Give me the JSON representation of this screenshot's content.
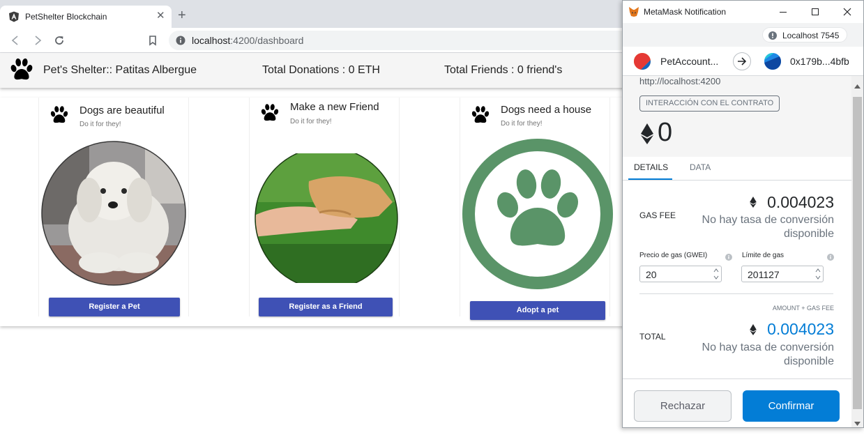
{
  "browser": {
    "tab_title": "PetShelter Blockchain",
    "tab_close": "✕",
    "new_tab": "+",
    "url_host": "localhost",
    "url_path": ":4200/dashboard"
  },
  "app": {
    "title": "Pet's Shelter:: Patitas Albergue",
    "donations": "Total Donations : 0 ETH",
    "friends": "Total Friends : 0 friend's"
  },
  "cards": [
    {
      "title": "Dogs are beautiful",
      "subtitle": "Do it for they!",
      "image": "white-dog-photo",
      "button": "Register a Pet"
    },
    {
      "title": "Make a new Friend",
      "subtitle": "Do it for they!",
      "image": "hand-and-paw-photo",
      "button": "Register as a Friend"
    },
    {
      "title": "Dogs need a house",
      "subtitle": "Do it for they!",
      "image": "green-paw-logo",
      "button": "Adopt a pet"
    }
  ],
  "metamask": {
    "window_title": "MetaMask Notification",
    "network": "Localhost 7545",
    "from_account": "PetAccount...",
    "to_account": "0x179b...4bfb",
    "origin": "http://localhost:4200",
    "interaction_badge": "INTERACCIÓN CON EL CONTRATO",
    "amount": "0",
    "tabs": {
      "details": "DETAILS",
      "data": "DATA"
    },
    "gas_fee_label": "GAS FEE",
    "gas_fee_value": "0.004023",
    "no_conversion": "No hay tasa de conversión disponible",
    "gas_price_label": "Precio de gas (GWEI)",
    "gas_price_value": "20",
    "gas_limit_label": "Límite de gas",
    "gas_limit_value": "201127",
    "amount_plus_fee_label": "AMOUNT + GAS FEE",
    "total_label": "TOTAL",
    "total_value": "0.004023",
    "reject_button": "Rechazar",
    "confirm_button": "Confirmar"
  },
  "colors": {
    "primary_button": "#3f51b5",
    "metamask_blue": "#037dd6",
    "paw_green": "#5a9468"
  }
}
